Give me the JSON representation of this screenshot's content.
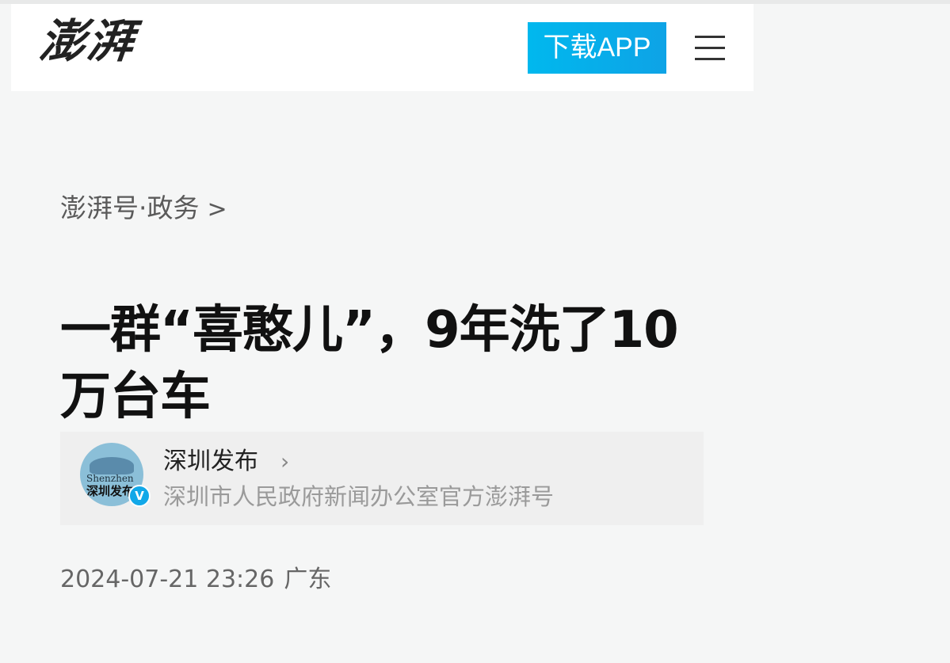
{
  "header": {
    "logo": "澎湃",
    "download_label": "下载APP"
  },
  "breadcrumb": {
    "label": "澎湃号·政务",
    "chevron": ">"
  },
  "article": {
    "title": "一群“喜憨儿”，9年洗了10万台车",
    "date": "2024-07-21 23:26",
    "location": "广东"
  },
  "author": {
    "name": "深圳发布",
    "chevron": "›",
    "description": "深圳市人民政府新闻办公室官方澎湃号",
    "avatar_text_en": "Shenzhen",
    "avatar_text_cn": "深圳发布",
    "verified_mark": "V"
  },
  "colors": {
    "accent": "#0ea3e6",
    "page_bg": "#f5f6f6",
    "card_bg": "#efefef"
  }
}
